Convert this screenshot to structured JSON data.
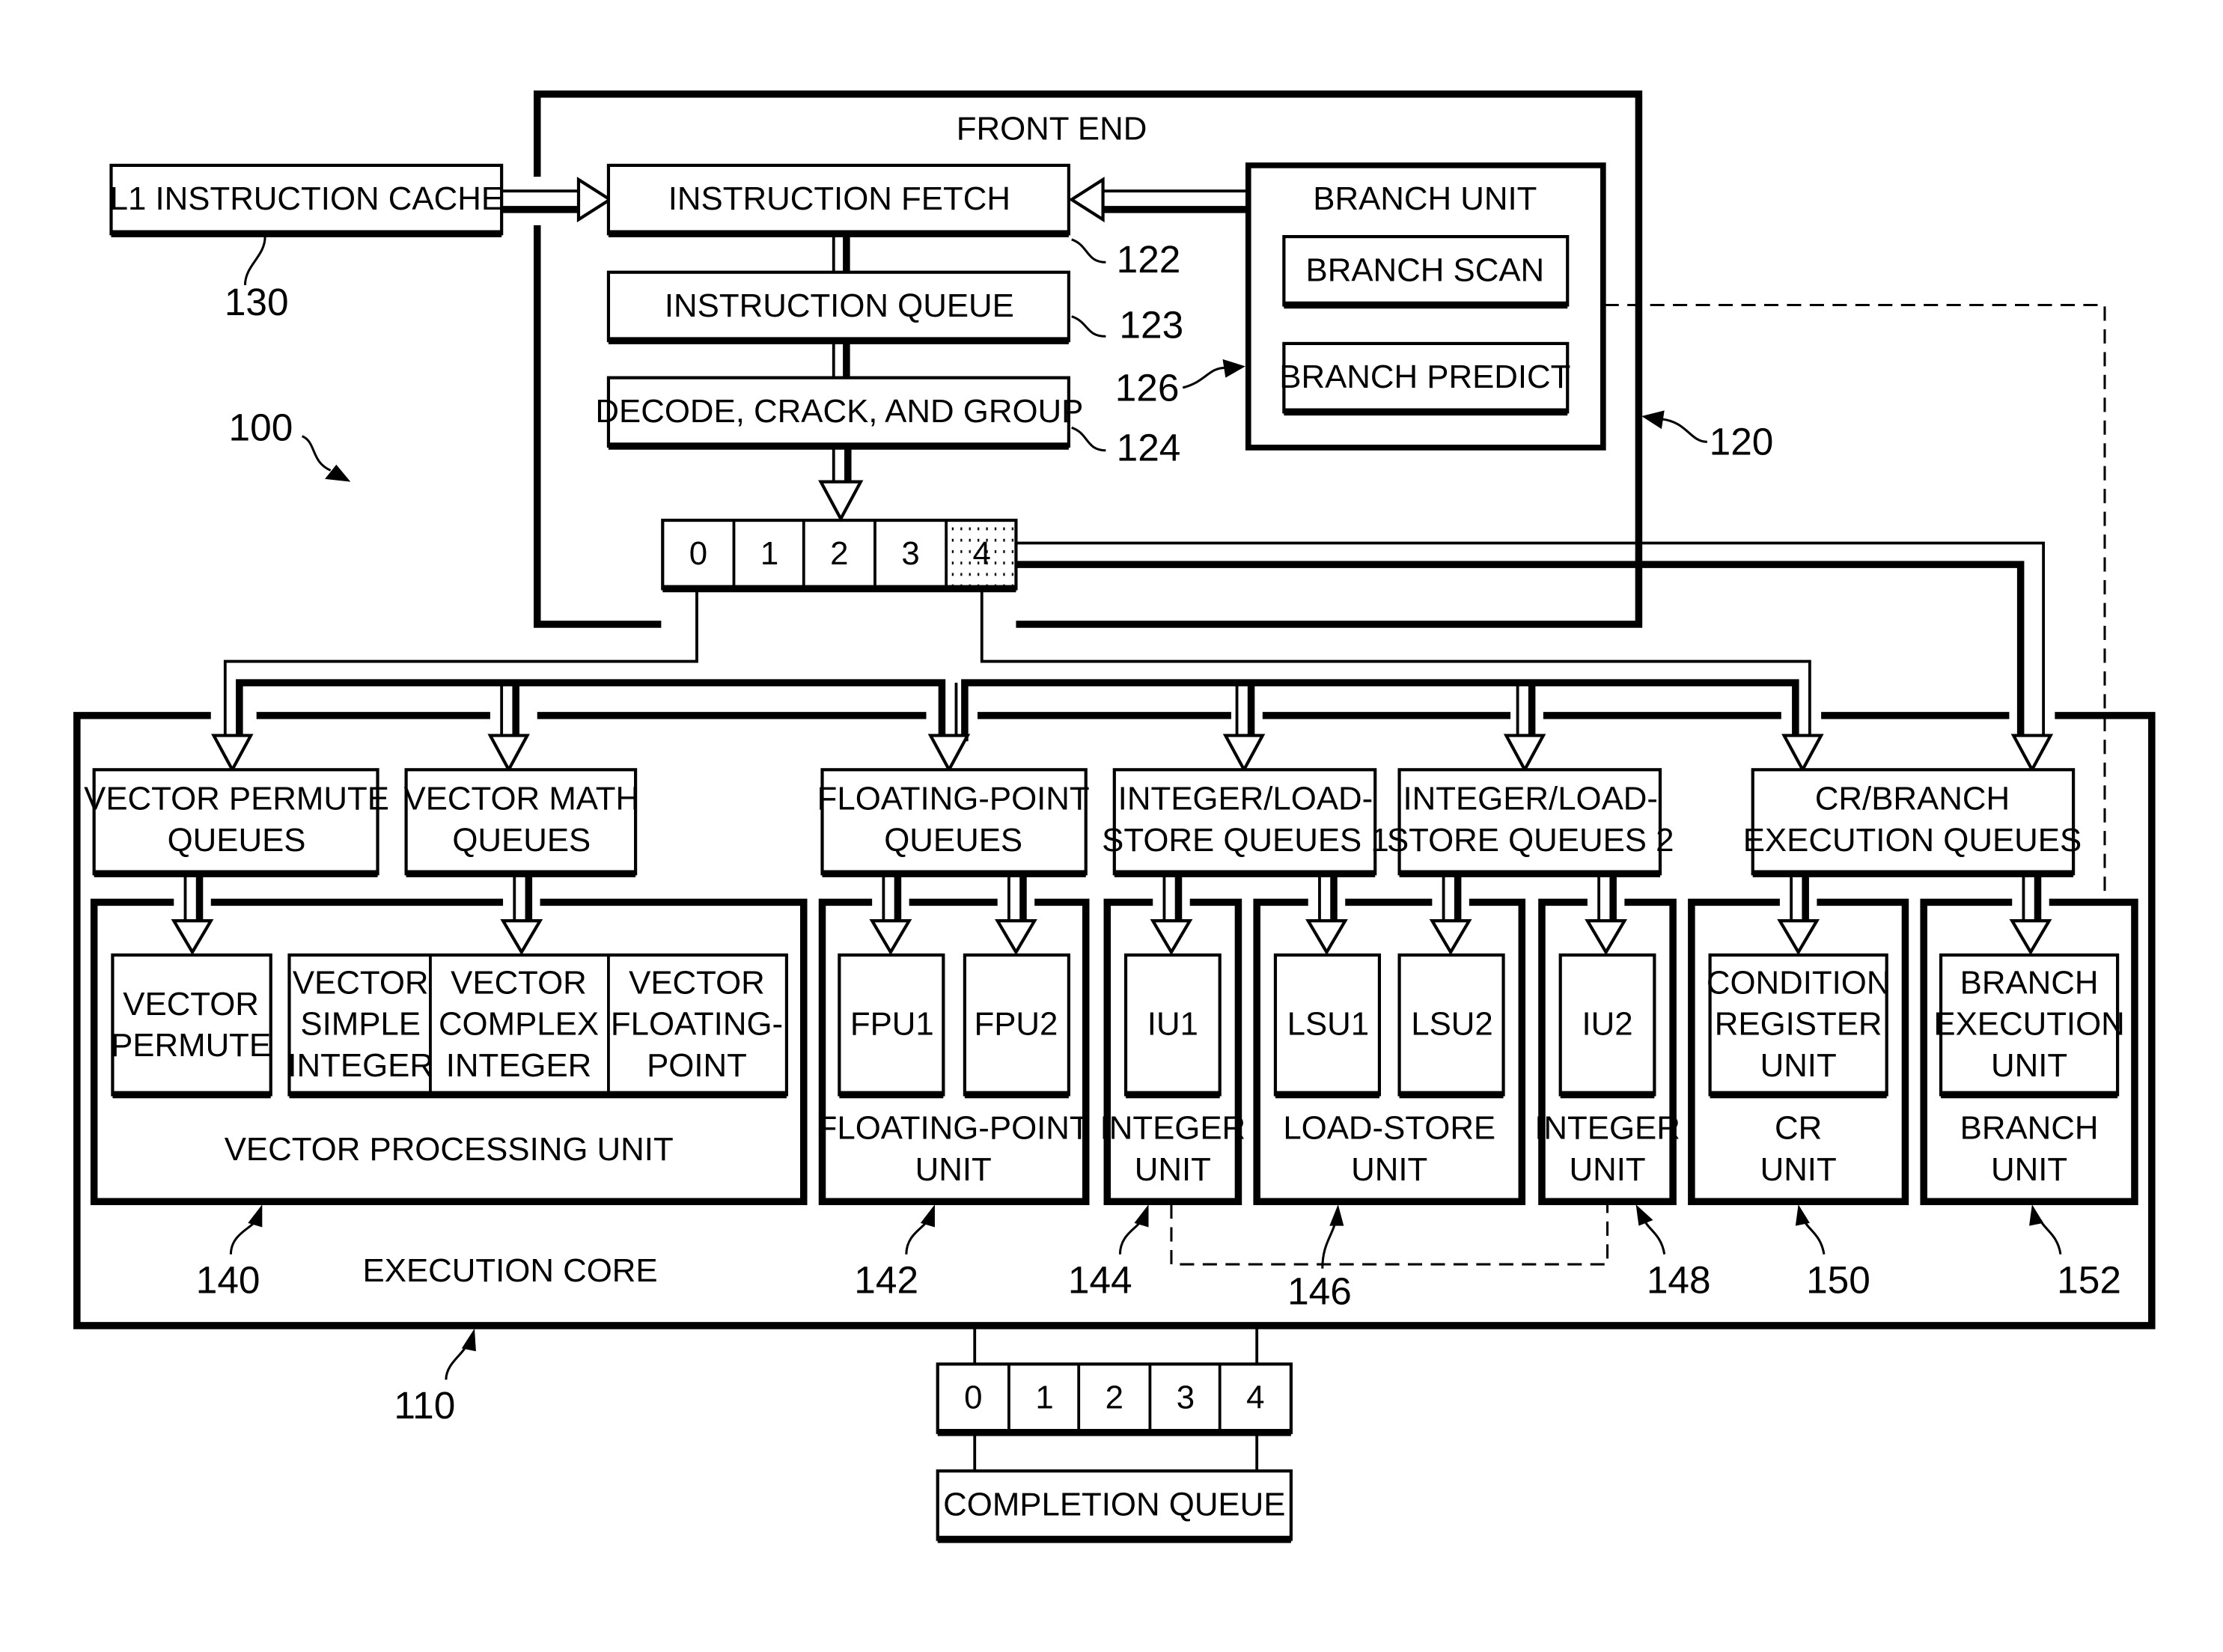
{
  "figure": {
    "system_ref": "100",
    "front_end": {
      "label": "FRONT END",
      "ref": "120"
    },
    "l1_cache": {
      "label": "L1 INSTRUCTION CACHE",
      "ref": "130"
    },
    "instruction_fetch": {
      "label": "INSTRUCTION FETCH",
      "ref": "122"
    },
    "instruction_queue": {
      "label": "INSTRUCTION QUEUE",
      "ref": "123"
    },
    "decode": {
      "label": "DECODE, CRACK, AND GROUP",
      "ref": "124"
    },
    "branch_unit_fe": {
      "label": "BRANCH UNIT",
      "ref": "126",
      "branch_scan": "BRANCH SCAN",
      "branch_predict": "BRANCH PREDICT"
    },
    "dispatch_group": {
      "slots": [
        "0",
        "1",
        "2",
        "3",
        "4"
      ],
      "highlighted_slot": "4"
    },
    "execution_core": {
      "label": "EXECUTION CORE",
      "ref": "110"
    },
    "queues": {
      "vector_permute": [
        "VECTOR PERMUTE",
        "QUEUES"
      ],
      "vector_math": [
        "VECTOR MATH",
        "QUEUES"
      ],
      "floating_point": [
        "FLOATING-POINT",
        "QUEUES"
      ],
      "int_ls_1": [
        "INTEGER/LOAD-",
        "STORE QUEUES 1"
      ],
      "int_ls_2": [
        "INTEGER/LOAD-",
        "STORE QUEUES 2"
      ],
      "cr_branch": [
        "CR/BRANCH",
        "EXECUTION QUEUES"
      ]
    },
    "units": {
      "vpu": {
        "label": "VECTOR PROCESSING UNIT",
        "ref": "140",
        "vector_permute": [
          "VECTOR",
          "PERMUTE"
        ],
        "simple_integer": [
          "VECTOR",
          "SIMPLE",
          "INTEGER"
        ],
        "complex_integer": [
          "VECTOR",
          "COMPLEX",
          "INTEGER"
        ],
        "floating_point": [
          "VECTOR",
          "FLOATING-",
          "POINT"
        ]
      },
      "fpu": {
        "label": [
          "FLOATING-POINT",
          "UNIT"
        ],
        "ref": "142",
        "fpu1": "FPU1",
        "fpu2": "FPU2"
      },
      "integer1": {
        "label": [
          "INTEGER",
          "UNIT"
        ],
        "ref": "144",
        "iu": "IU1"
      },
      "load_store": {
        "label": [
          "LOAD-STORE",
          "UNIT"
        ],
        "ref": "146",
        "lsu1": "LSU1",
        "lsu2": "LSU2"
      },
      "integer2": {
        "label": [
          "INTEGER",
          "UNIT"
        ],
        "ref": "148",
        "iu": "IU2"
      },
      "cr": {
        "label": [
          "CR",
          "UNIT"
        ],
        "ref": "150",
        "inner": [
          "CONDITION",
          "REGISTER",
          "UNIT"
        ]
      },
      "branch": {
        "label": [
          "BRANCH",
          "UNIT"
        ],
        "ref": "152",
        "inner": [
          "BRANCH",
          "EXECUTION",
          "UNIT"
        ]
      }
    },
    "completion": {
      "slots": [
        "0",
        "1",
        "2",
        "3",
        "4"
      ],
      "label": "COMPLETION QUEUE"
    }
  }
}
